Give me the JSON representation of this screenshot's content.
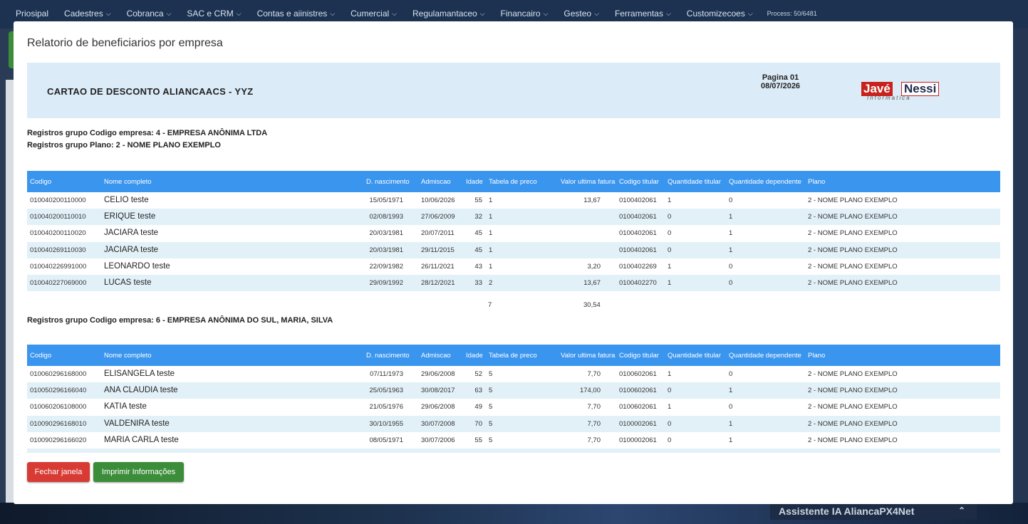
{
  "nav": {
    "items": [
      "Priosipal",
      "Cadestres",
      "Cobranca",
      "SAC e CRM",
      "Contas e aiinistres",
      "Cumercial",
      "Regulamantaceo",
      "Financairo",
      "Gesteo",
      "Ferramentas",
      "Customizecoes"
    ],
    "process": "Process: 50/6481"
  },
  "modal": {
    "title": "Relatorio de beneficiarios por empresa",
    "report_title": "CARTAO DE DESCONTO ALIANCAACS - YYZ",
    "page_label": "Pagina 01",
    "date": "08/07/2026",
    "logo": {
      "part1": "Javé",
      "part2": "Nessi",
      "tagline": "Informatica"
    }
  },
  "columns": [
    "Codigo",
    "Nome completo",
    "D. nascimento",
    "Admiscao",
    "Idade",
    "Tabela de preco",
    "Valor ultima fatura",
    "Codigo titular",
    "Quantidade titular",
    "Quantidade dependente",
    "Plano"
  ],
  "group1": {
    "company": "Registros grupo Codigo empresa: 4 - EMPRESA ANÔNIMA LTDA",
    "plan": "Registros grupo Plano: 2 - NOME PLANO EXEMPLO",
    "rows": [
      [
        "010040200110000",
        "CELIO teste",
        "15/05/1971",
        "10/06/2026",
        "55",
        "1",
        "13,67",
        "0100402061",
        "1",
        "0",
        "2 - NOME PLANO EXEMPLO"
      ],
      [
        "010040200110010",
        "ERIQUE teste",
        "02/08/1993",
        "27/06/2009",
        "32",
        "1",
        "",
        "0100402061",
        "0",
        "1",
        "2 - NOME PLANO EXEMPLO"
      ],
      [
        "010040200110020",
        "JACIARA teste",
        "20/03/1981",
        "20/07/2011",
        "45",
        "1",
        "",
        "0100402061",
        "0",
        "1",
        "2 - NOME PLANO EXEMPLO"
      ],
      [
        "010040269110030",
        "JACIARA teste",
        "20/03/1981",
        "29/11/2015",
        "45",
        "1",
        "",
        "0100402061",
        "0",
        "1",
        "2 - NOME PLANO EXEMPLO"
      ],
      [
        "010040226991000",
        "LEONARDO teste",
        "22/09/1982",
        "26/11/2021",
        "43",
        "1",
        "3,20",
        "0100402269",
        "1",
        "0",
        "2 - NOME PLANO EXEMPLO"
      ],
      [
        "010040227069000",
        "LUCAS teste",
        "29/09/1992",
        "28/12/2021",
        "33",
        "2",
        "13,67",
        "0100402270",
        "1",
        "0",
        "2 - NOME PLANO EXEMPLO"
      ]
    ],
    "total_count": "7",
    "total_value": "30,54"
  },
  "group2": {
    "company": "Registros grupo Codigo empresa: 6 - EMPRESA ANÔNIMA DO SUL, MARIA, SILVA",
    "rows": [
      [
        "010060296168000",
        "ELISANGELA teste",
        "07/11/1973",
        "29/06/2008",
        "52",
        "5",
        "7,70",
        "0100602061",
        "1",
        "0",
        "2 - NOME PLANO EXEMPLO"
      ],
      [
        "010050296166040",
        "ANA CLAUDIA teste",
        "25/05/1963",
        "30/08/2017",
        "63",
        "5",
        "174,00",
        "0100602061",
        "0",
        "1",
        "2 - NOME PLANO EXEMPLO"
      ],
      [
        "010060206108000",
        "KATIA teste",
        "21/05/1976",
        "29/06/2008",
        "49",
        "5",
        "7,70",
        "0100602061",
        "1",
        "0",
        "2 - NOME PLANO EXEMPLO"
      ],
      [
        "010090296168010",
        "VALDENIRA teste",
        "30/10/1955",
        "30/07/2008",
        "70",
        "5",
        "7,70",
        "0100002061",
        "0",
        "1",
        "2 - NOME PLANO EXEMPLO"
      ],
      [
        "010090296166020",
        "MARIA CARLA teste",
        "08/05/1971",
        "30/07/2006",
        "55",
        "5",
        "7,70",
        "0100002061",
        "0",
        "1",
        "2 - NOME PLANO EXEMPLO"
      ]
    ]
  },
  "buttons": {
    "close": "Fechar janela",
    "print": "Imprimir Informações"
  },
  "assistant": "Assistente IA AliancaPX4Net"
}
